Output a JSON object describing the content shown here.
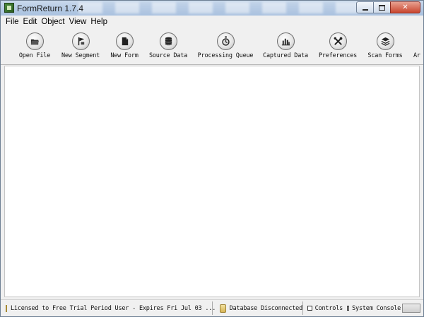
{
  "window": {
    "title": "FormReturn 1.7.4",
    "controls": {
      "minimize": "minimize",
      "maximize": "maximize",
      "close": "✕"
    }
  },
  "menu": [
    "File",
    "Edit",
    "Object",
    "View",
    "Help"
  ],
  "toolbar": {
    "buttons": [
      {
        "label": "Open File",
        "icon": "open-file-icon"
      },
      {
        "label": "New Segment",
        "icon": "flag-icon"
      },
      {
        "label": "New Form",
        "icon": "document-icon"
      },
      {
        "label": "Source Data",
        "icon": "database-icon"
      },
      {
        "label": "Processing Queue",
        "icon": "stopwatch-icon"
      },
      {
        "label": "Captured Data",
        "icon": "bar-chart-icon"
      },
      {
        "label": "Preferences",
        "icon": "tools-icon"
      },
      {
        "label": "Scan Forms",
        "icon": "layers-icon"
      },
      {
        "label": "Ar",
        "icon": "cut-off"
      }
    ]
  },
  "statusbar": {
    "license": "Licensed to Free Trial Period User - Expires Fri Jul 03 ...",
    "database": "Database Disconnected",
    "controls": "Controls",
    "console": "System Console"
  },
  "colors": {
    "titlebar": "#b9cde6",
    "chrome": "#f0f0f0",
    "close_button": "#c9462f"
  }
}
